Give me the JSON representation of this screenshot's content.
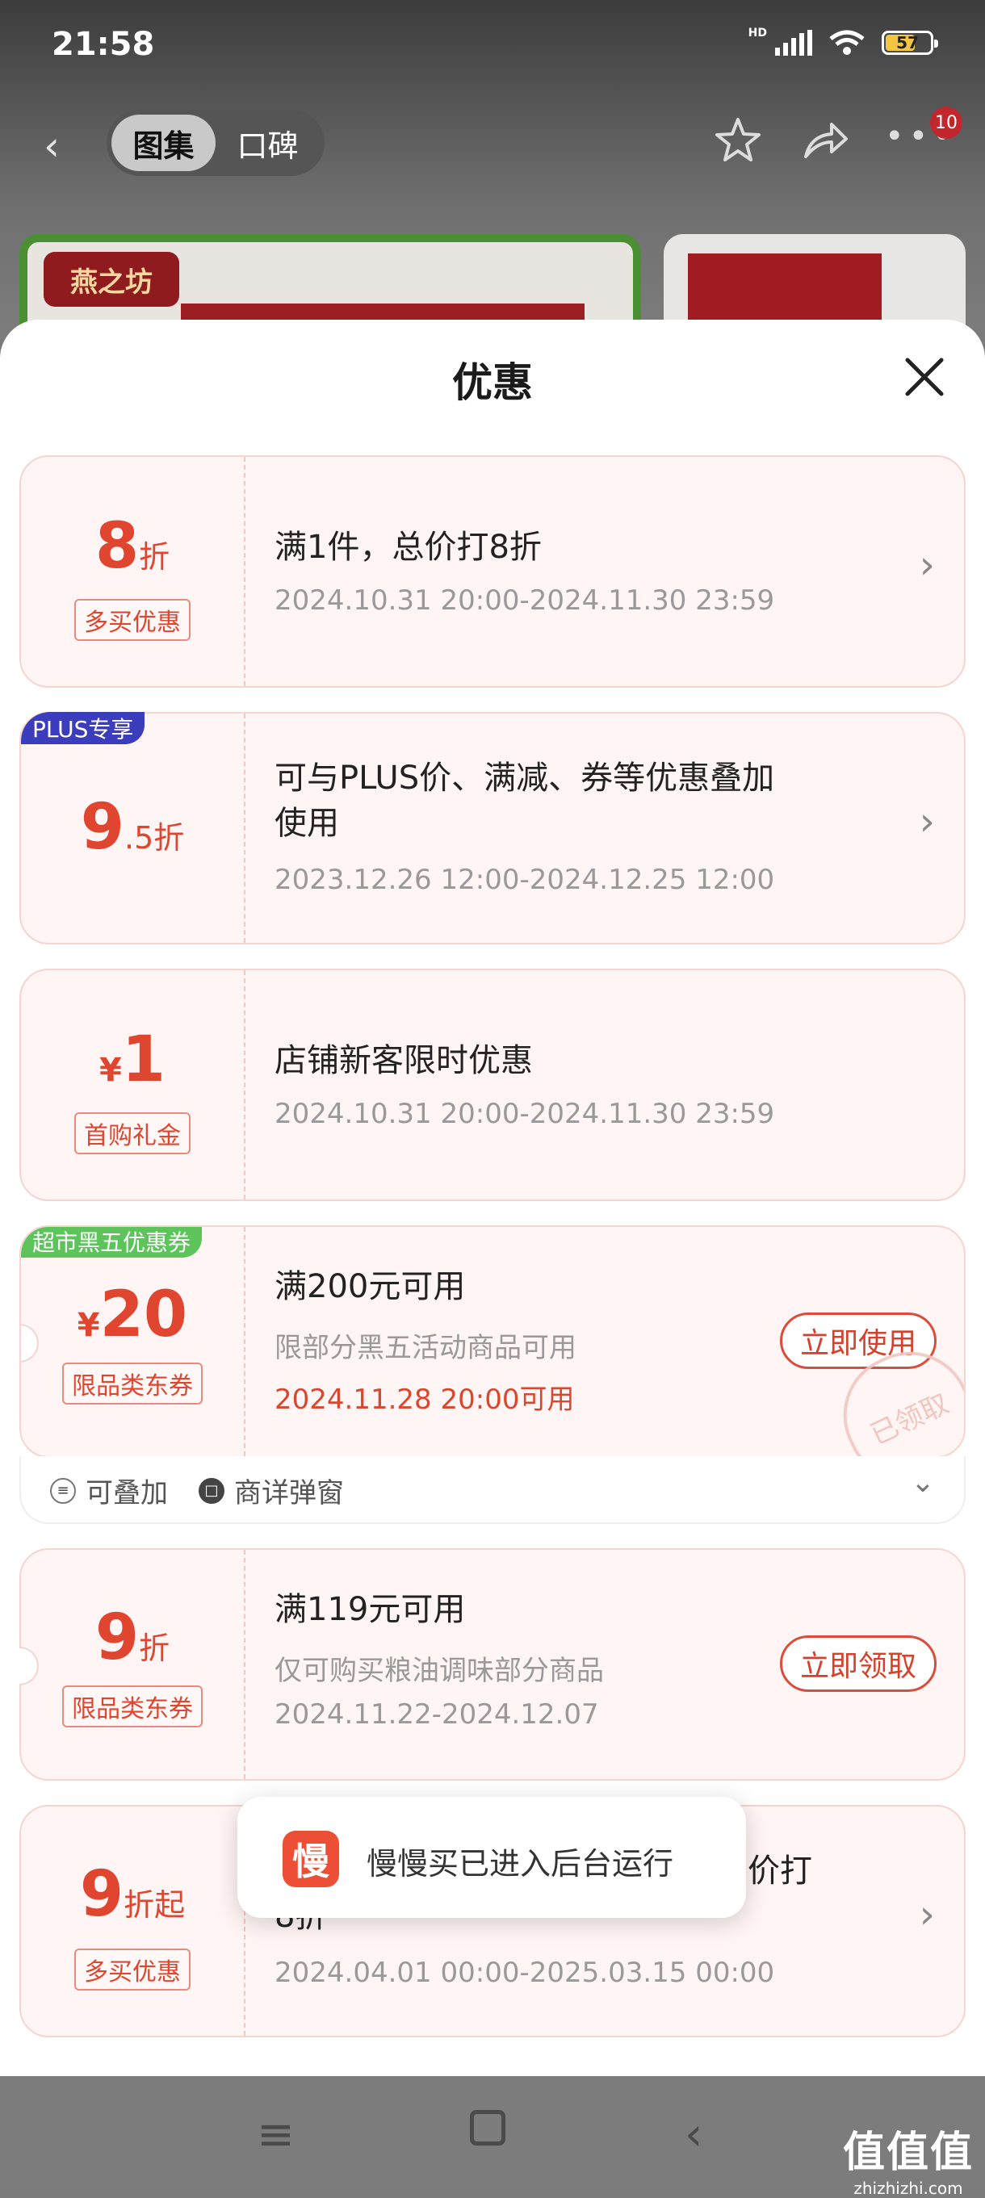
{
  "status_bar": {
    "time": "21:58",
    "network": "HD",
    "battery": "57"
  },
  "header": {
    "tabs": [
      {
        "label": "图集",
        "active": true
      },
      {
        "label": "口碑",
        "active": false
      }
    ],
    "badge_count": "10"
  },
  "thumbnail": {
    "brand": "燕之坊"
  },
  "sheet": {
    "title": "优惠"
  },
  "offers": [
    {
      "value": "8",
      "unit": "折",
      "tag": "多买优惠",
      "title": "满1件，总价打8折",
      "date": "2024.10.31 20:00-2024.11.30 23:59"
    },
    {
      "corner": "PLUS专享",
      "value": "9",
      "unit": ".5折",
      "title_line1": "可与PLUS价、满减、券等优惠叠加",
      "title_line2": "使用",
      "date": "2023.12.26 12:00-2024.12.25 12:00"
    },
    {
      "prefix": "¥",
      "value": "1",
      "tag": "首购礼金",
      "title": "店铺新客限时优惠",
      "date": "2024.10.31 20:00-2024.11.30 23:59"
    },
    {
      "corner": "超市黑五优惠券",
      "prefix": "¥",
      "value": "20",
      "tag": "限品类东券",
      "title": "满200元可用",
      "subtitle": "限部分黑五活动商品可用",
      "date": "2024.11.28 20:00可用",
      "button": "立即使用",
      "stamp": "已领取",
      "extras": [
        "可叠加",
        "商详弹窗"
      ]
    },
    {
      "value": "9",
      "unit": "折",
      "tag": "限品类东券",
      "title": "满119元可用",
      "subtitle": "仅可购买粮油调味部分商品",
      "date": "2024.11.22-2024.12.07",
      "button": "立即领取"
    },
    {
      "value": "9",
      "unit": "折起",
      "tag": "多买优惠",
      "title_tail": "价打",
      "title_line2": "8折",
      "date": "2024.04.01 00:00-2025.03.15 00:00"
    }
  ],
  "toast": {
    "icon_char": "慢",
    "message": "慢慢买已进入后台运行"
  },
  "watermark": {
    "line1": "值值值",
    "line2": "zhizhizhi.com"
  }
}
